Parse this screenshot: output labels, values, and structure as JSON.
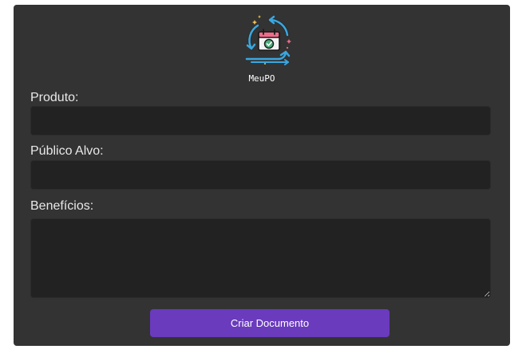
{
  "brand": {
    "name": "MeuPO",
    "logo_icon": "calendar-cycle-icon"
  },
  "form": {
    "product_label": "Produto:",
    "product_value": "",
    "audience_label": "Público Alvo:",
    "audience_value": "",
    "benefits_label": "Benefícios:",
    "benefits_value": "",
    "submit_label": "Criar Documento"
  },
  "colors": {
    "card_background": "#333333",
    "field_background": "#222222",
    "button_background": "#6a3bbd",
    "logo_blue": "#3aa7e0",
    "logo_pink": "#f06b8a"
  }
}
